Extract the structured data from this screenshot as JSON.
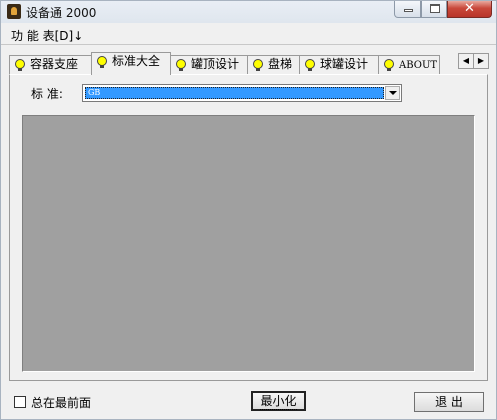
{
  "window": {
    "title": "设备通 2000"
  },
  "menu": {
    "item": "功 能 表[D]↓"
  },
  "tabs": [
    {
      "label": "容器支座"
    },
    {
      "label": "标准大全"
    },
    {
      "label": "罐顶设计"
    },
    {
      "label": "盘梯"
    },
    {
      "label": "球罐设计"
    },
    {
      "label": "ABOUT"
    }
  ],
  "active_tab_index": 1,
  "standard": {
    "label": "标  准:",
    "value": "GB"
  },
  "bottom": {
    "always_on_top_label": "总在最前面",
    "always_on_top_checked": false,
    "minimize_label": "最小化",
    "exit_label": "退  出"
  },
  "colors": {
    "bulb": "#ffff00",
    "selection": "#3399ff",
    "content_area": "#a0a0a0"
  }
}
